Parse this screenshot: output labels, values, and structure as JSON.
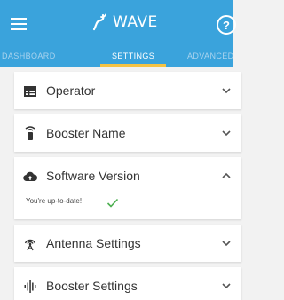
{
  "app": {
    "title": "WAVE",
    "icons": {
      "menu": "hamburger-menu-icon",
      "logo": "wave-logo-icon",
      "help": "help-circle-icon"
    }
  },
  "tabs": [
    {
      "label": "DASHBOARD",
      "active": false
    },
    {
      "label": "SETTINGS",
      "active": true
    },
    {
      "label": "ADVANCED",
      "active": false
    }
  ],
  "sections": {
    "operator": {
      "title": "Operator",
      "icon": "sim-card-icon",
      "expanded": false
    },
    "booster_name": {
      "title": "Booster Name",
      "icon": "booster-device-icon",
      "expanded": false
    },
    "software_version": {
      "title": "Software Version",
      "icon": "cloud-upload-icon",
      "expanded": true,
      "status": "You're up-to-date!"
    },
    "antenna_settings": {
      "title": "Antenna Settings",
      "icon": "antenna-icon",
      "expanded": false
    },
    "booster_settings": {
      "title": "Booster Settings",
      "icon": "signal-bars-icon",
      "expanded": false
    }
  },
  "colors": {
    "primary": "#3aa3dc",
    "tab_indicator": "#f6c343",
    "check": "#4caf50",
    "background": "#f2f2f2"
  }
}
